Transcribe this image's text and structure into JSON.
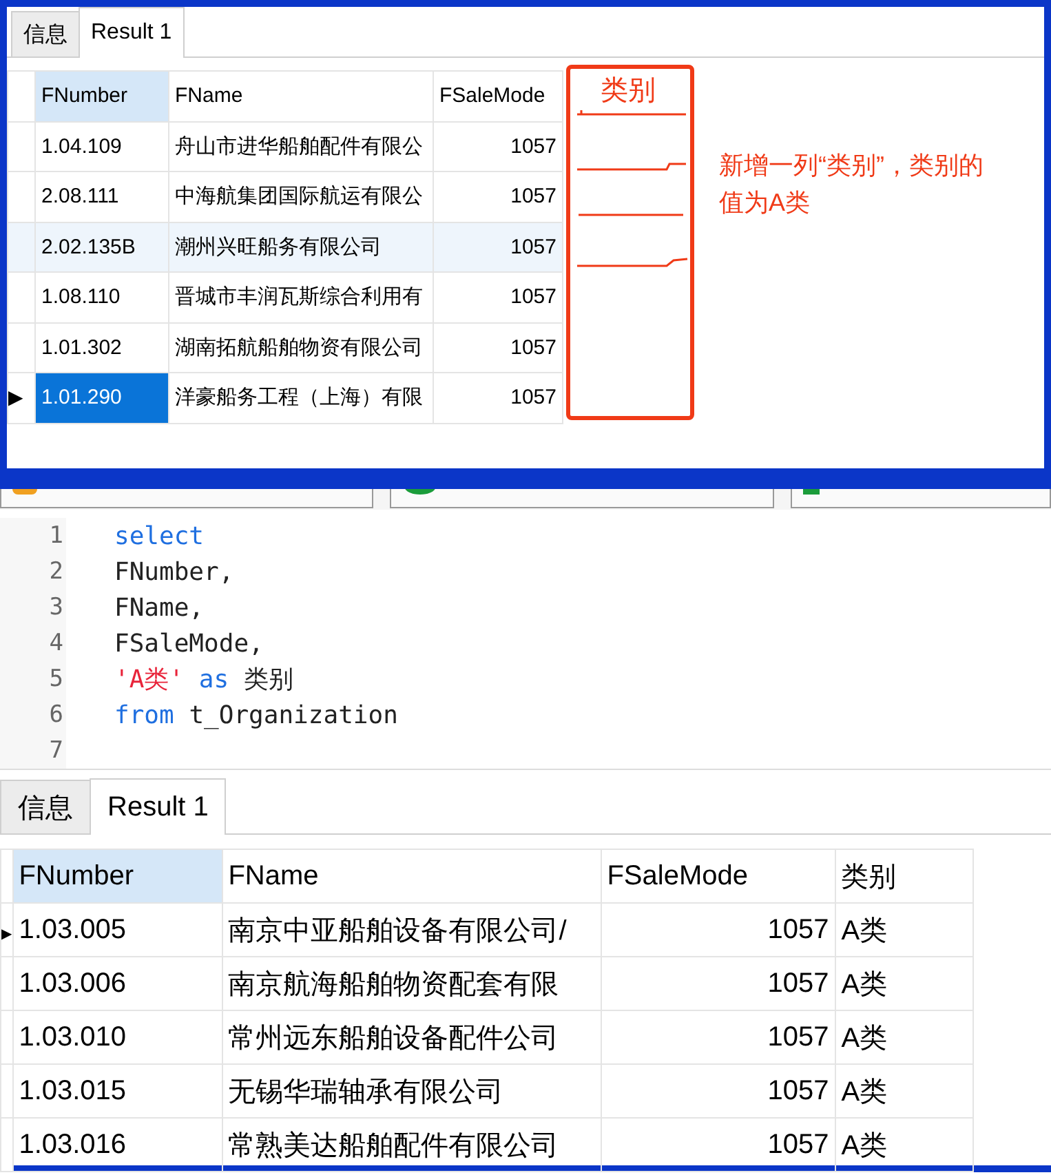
{
  "top_panel": {
    "tabs": [
      {
        "label": "信息",
        "selected": false
      },
      {
        "label": "Result 1",
        "selected": true
      }
    ],
    "grid": {
      "current_marker": "▶",
      "columns": [
        {
          "label": "FNumber",
          "selected": true
        },
        {
          "label": "FName",
          "selected": false
        },
        {
          "label": "FSaleMode",
          "selected": false
        }
      ],
      "rows": [
        {
          "cells": [
            "1.04.109",
            "舟山市进华船舶配件有限公",
            "1057"
          ],
          "current": false,
          "selected": false,
          "highlighted": false
        },
        {
          "cells": [
            "2.08.111",
            "中海航集团国际航运有限公",
            "1057"
          ],
          "current": false,
          "selected": false,
          "highlighted": false
        },
        {
          "cells": [
            "2.02.135B",
            "潮州兴旺船务有限公司",
            "1057"
          ],
          "current": false,
          "selected": false,
          "highlighted": true
        },
        {
          "cells": [
            "1.08.110",
            "晋城市丰润瓦斯综合利用有",
            "1057"
          ],
          "current": false,
          "selected": false,
          "highlighted": false
        },
        {
          "cells": [
            "1.01.302",
            "湖南拓航船舶物资有限公司",
            "1057"
          ],
          "current": false,
          "selected": false,
          "highlighted": false
        },
        {
          "cells": [
            "1.01.290",
            "洋豪船务工程（上海）有限",
            "1057"
          ],
          "current": true,
          "selected": true,
          "highlighted": false
        }
      ]
    },
    "annotation": {
      "column_label": "类别",
      "note": "新增一列“类别”，类别的值为A类"
    }
  },
  "editor": {
    "lines": [
      {
        "number": "1",
        "tokens": [
          {
            "text": "select",
            "kind": "keyword"
          }
        ]
      },
      {
        "number": "2",
        "tokens": [
          {
            "text": "FNumber,",
            "kind": "ident"
          }
        ]
      },
      {
        "number": "3",
        "tokens": [
          {
            "text": "FName,",
            "kind": "ident"
          }
        ]
      },
      {
        "number": "4",
        "tokens": [
          {
            "text": "FSaleMode,",
            "kind": "ident"
          }
        ]
      },
      {
        "number": "5",
        "tokens": [
          {
            "text": "'A类'",
            "kind": "string"
          },
          {
            "text": " as ",
            "kind": "keyword"
          },
          {
            "text": "类别",
            "kind": "ident"
          }
        ]
      },
      {
        "number": "6",
        "tokens": [
          {
            "text": "from",
            "kind": "keyword"
          },
          {
            "text": " t_Organization",
            "kind": "ident"
          }
        ]
      },
      {
        "number": "7"
      }
    ]
  },
  "bottom_panel": {
    "tabs": [
      {
        "label": "信息",
        "selected": false
      },
      {
        "label": "Result 1",
        "selected": true
      }
    ],
    "grid": {
      "current_marker": "▶",
      "columns": [
        {
          "label": "FNumber",
          "selected": true
        },
        {
          "label": "FName",
          "selected": false
        },
        {
          "label": "FSaleMode",
          "selected": false
        },
        {
          "label": "类别",
          "selected": false
        }
      ],
      "rows": [
        {
          "cells": [
            "1.03.005",
            "南京中亚船舶设备有限公司/",
            "1057",
            "A类"
          ],
          "current": true,
          "selected": false,
          "highlighted": false
        },
        {
          "cells": [
            "1.03.006",
            "南京航海船舶物资配套有限",
            "1057",
            "A类"
          ],
          "current": false,
          "selected": false,
          "highlighted": false
        },
        {
          "cells": [
            "1.03.010",
            "常州远东船舶设备配件公司",
            "1057",
            "A类"
          ],
          "current": false,
          "selected": false,
          "highlighted": false
        },
        {
          "cells": [
            "1.03.015",
            "无锡华瑞轴承有限公司",
            "1057",
            "A类"
          ],
          "current": false,
          "selected": false,
          "highlighted": false
        },
        {
          "cells": [
            "1.03.016",
            "常熟美达船舶配件有限公司",
            "1057",
            "A类"
          ],
          "current": false,
          "selected": false,
          "highlighted": false
        }
      ]
    }
  }
}
